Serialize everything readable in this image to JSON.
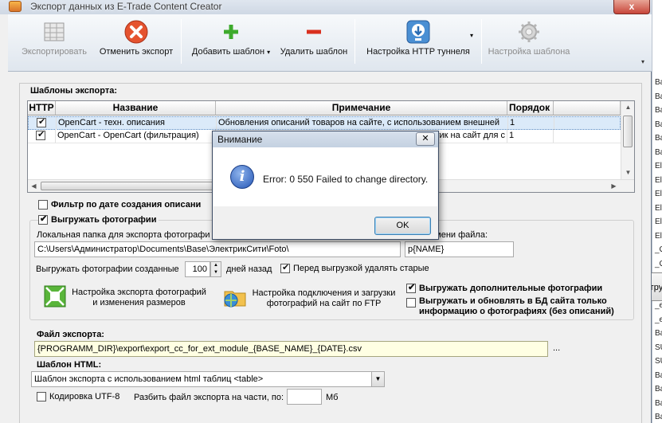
{
  "window": {
    "title": "Экспорт данных из E-Trade Content Creator",
    "close_label": "x"
  },
  "toolbar": {
    "export": "Экспортировать",
    "cancel_export": "Отменить экспорт",
    "add_template": "Добавить шаблон",
    "delete_template": "Удалить шаблон",
    "http_tunnel": "Настройка HTTP туннеля",
    "template_settings": "Настройка шаблона",
    "more": "▾"
  },
  "templates": {
    "section_label": "Шаблоны экспорта:",
    "columns": [
      "HTTP",
      "Название",
      "Примечание",
      "Порядок"
    ],
    "rows": [
      {
        "http": true,
        "name": "OpenCart - техн. описания",
        "note": "Обновления описаний товаров на сайте, с использованием внешней",
        "order": "1",
        "selected": true
      },
      {
        "http": true,
        "name": "OpenCart - OpenCart (фильтрация)",
        "note": "тик на сайт для с",
        "order": "1",
        "selected": false
      }
    ]
  },
  "filter": {
    "date_filter_label": "Фильтр по дате создания описани",
    "date_filter_checked": false
  },
  "photos": {
    "export_photos_label": "Выгружать фотографии",
    "export_photos_checked": true,
    "local_folder_label": "Локальная папка для экспорта фотографи",
    "local_folder_value": "C:\\Users\\Администратор\\Documents\\Base\\ЭлектрикСити\\Foto\\",
    "file_name_label": "имени файла:",
    "file_name_value": "p{NAME}",
    "created_prefix": "Выгружать фотографии созданные",
    "days_value": "100",
    "days_suffix": "дней назад",
    "delete_old_label": "Перед выгрузкой удалять старые",
    "delete_old_checked": true,
    "resize_settings": "Настройка экспорта фотографий и изменения размеров",
    "ftp_settings": "Настройка подключения и загрузки фотографий на сайт по FTP",
    "extra_photos_label": "Выгружать дополнительные фотографии",
    "extra_photos_checked": true,
    "update_db_label": "Выгружать и обновлять в БД сайта только информацию о фотографиях (без описаний)",
    "update_db_checked": false
  },
  "export_file": {
    "label": "Файл экспорта:",
    "value": "{PROGRAMM_DIR}\\export\\export_cc_for_ext_module_{BASE_NAME}_{DATE}.csv",
    "browse": "..."
  },
  "html_template": {
    "label": "Шаблон HTML:",
    "selected": "Шаблон экспорта с использованием html таблиц <table>"
  },
  "encoding": {
    "utf8_label": "Кодировка UTF-8",
    "utf8_checked": false,
    "split_label": "Разбить файл экспорта на части, по:",
    "split_value": "",
    "unit": "Мб"
  },
  "dialog": {
    "title": "Внимание",
    "message": "Error: 0 550 Failed to change directory.",
    "ok": "OK",
    "close": "✕"
  },
  "background": {
    "button_label": "Загру",
    "right_fragments": [
      "Ba",
      "Ba",
      "Ba",
      "Ba",
      "Ba",
      "Ba",
      "El",
      "El",
      "El",
      "El",
      "El",
      "El",
      "_G",
      "_G",
      "El",
      "El",
      "_e",
      "_e",
      "Ba",
      "SU",
      "SU",
      "Ba",
      "Ba",
      "Ba",
      "Ba"
    ]
  }
}
